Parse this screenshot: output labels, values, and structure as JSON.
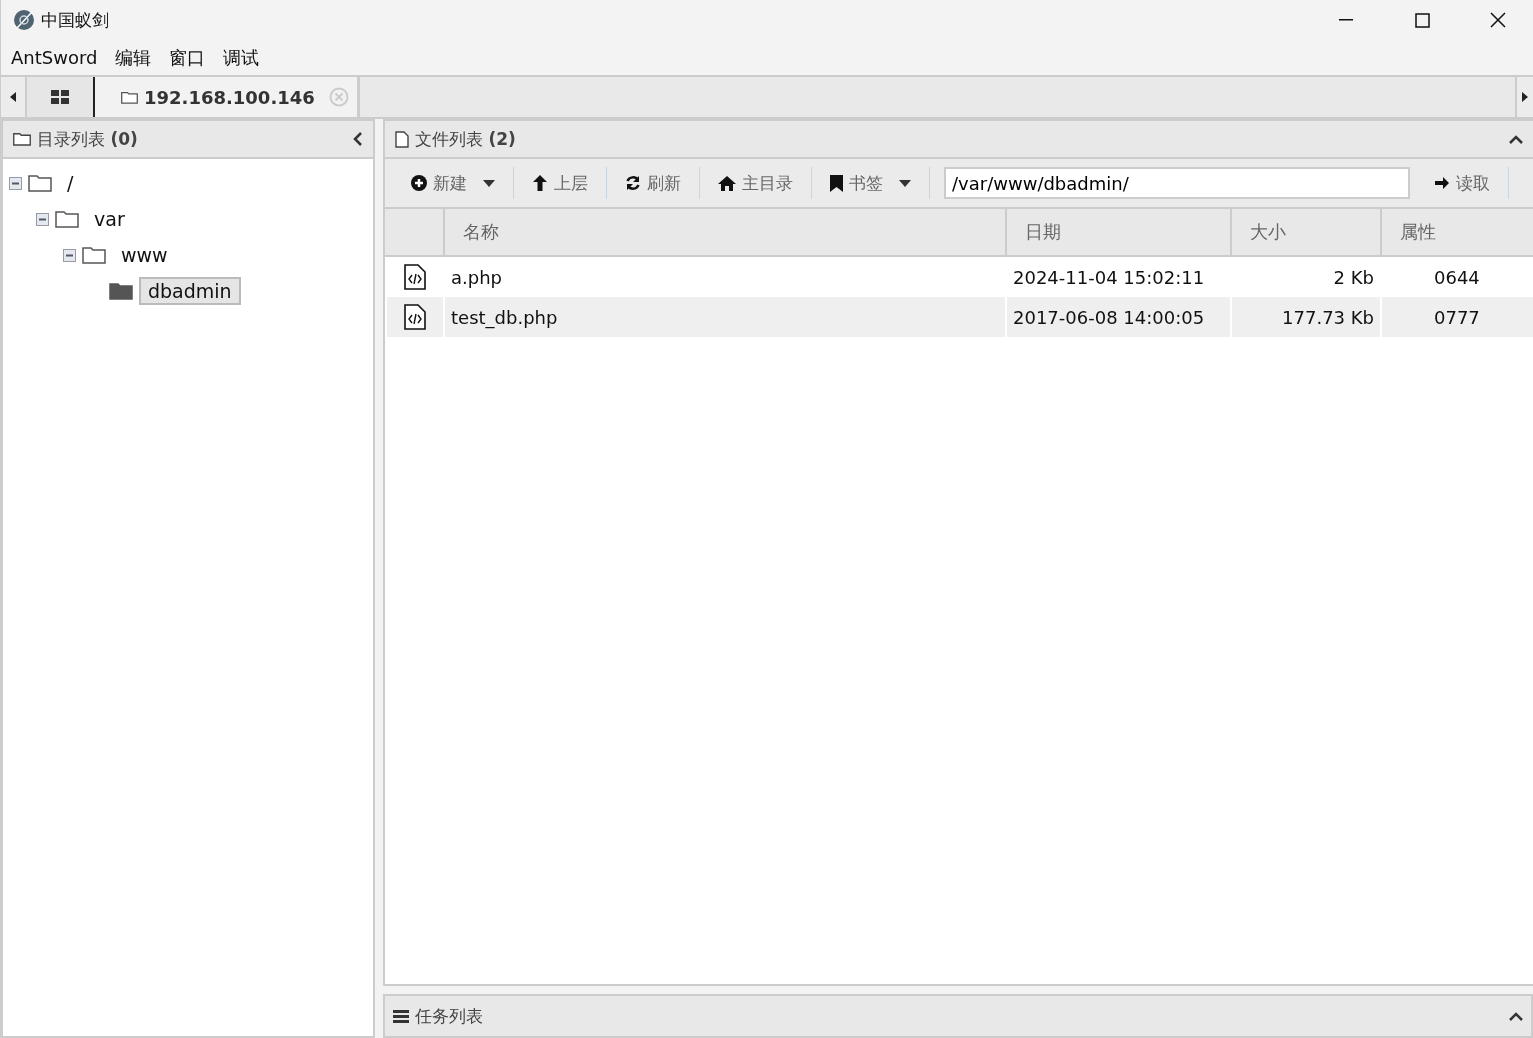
{
  "window": {
    "title": "中国蚁剑"
  },
  "menu": [
    "AntSword",
    "编辑",
    "窗口",
    "调试"
  ],
  "tabs": [
    {
      "kind": "home",
      "selected": false
    },
    {
      "kind": "host",
      "label": "192.168.100.146",
      "selected": true
    }
  ],
  "directory_panel": {
    "title": "目录列表",
    "count": "(0)",
    "tree": [
      {
        "label": "/",
        "expanded": true,
        "selected": false,
        "children": [
          {
            "label": "var",
            "expanded": true,
            "selected": false,
            "children": [
              {
                "label": "www",
                "expanded": true,
                "selected": false,
                "children": [
                  {
                    "label": "dbadmin",
                    "selected": true
                  }
                ]
              }
            ]
          }
        ]
      }
    ]
  },
  "file_panel": {
    "title": "文件列表",
    "count": "(2)",
    "toolbar": [
      {
        "kind": "new",
        "label": "新建",
        "dropdown": true
      },
      {
        "kind": "up",
        "label": "上层",
        "dropdown": false
      },
      {
        "kind": "refresh",
        "label": "刷新",
        "dropdown": false
      },
      {
        "kind": "home",
        "label": "主目录",
        "dropdown": false
      },
      {
        "kind": "bookmark",
        "label": "书签",
        "dropdown": true
      }
    ],
    "path": "/var/www/dbadmin/",
    "read_button": "读取",
    "columns": [
      "名称",
      "日期",
      "大小",
      "属性"
    ],
    "rows": [
      {
        "name": "a.php",
        "date": "2024-11-04 15:02:11",
        "size": "2 Kb",
        "perm": "0644",
        "selected": false
      },
      {
        "name": "test_db.php",
        "date": "2017-06-08 14:00:05",
        "size": "177.73 Kb",
        "perm": "0777",
        "selected": true
      }
    ]
  },
  "task_panel": {
    "title": "任务列表"
  }
}
